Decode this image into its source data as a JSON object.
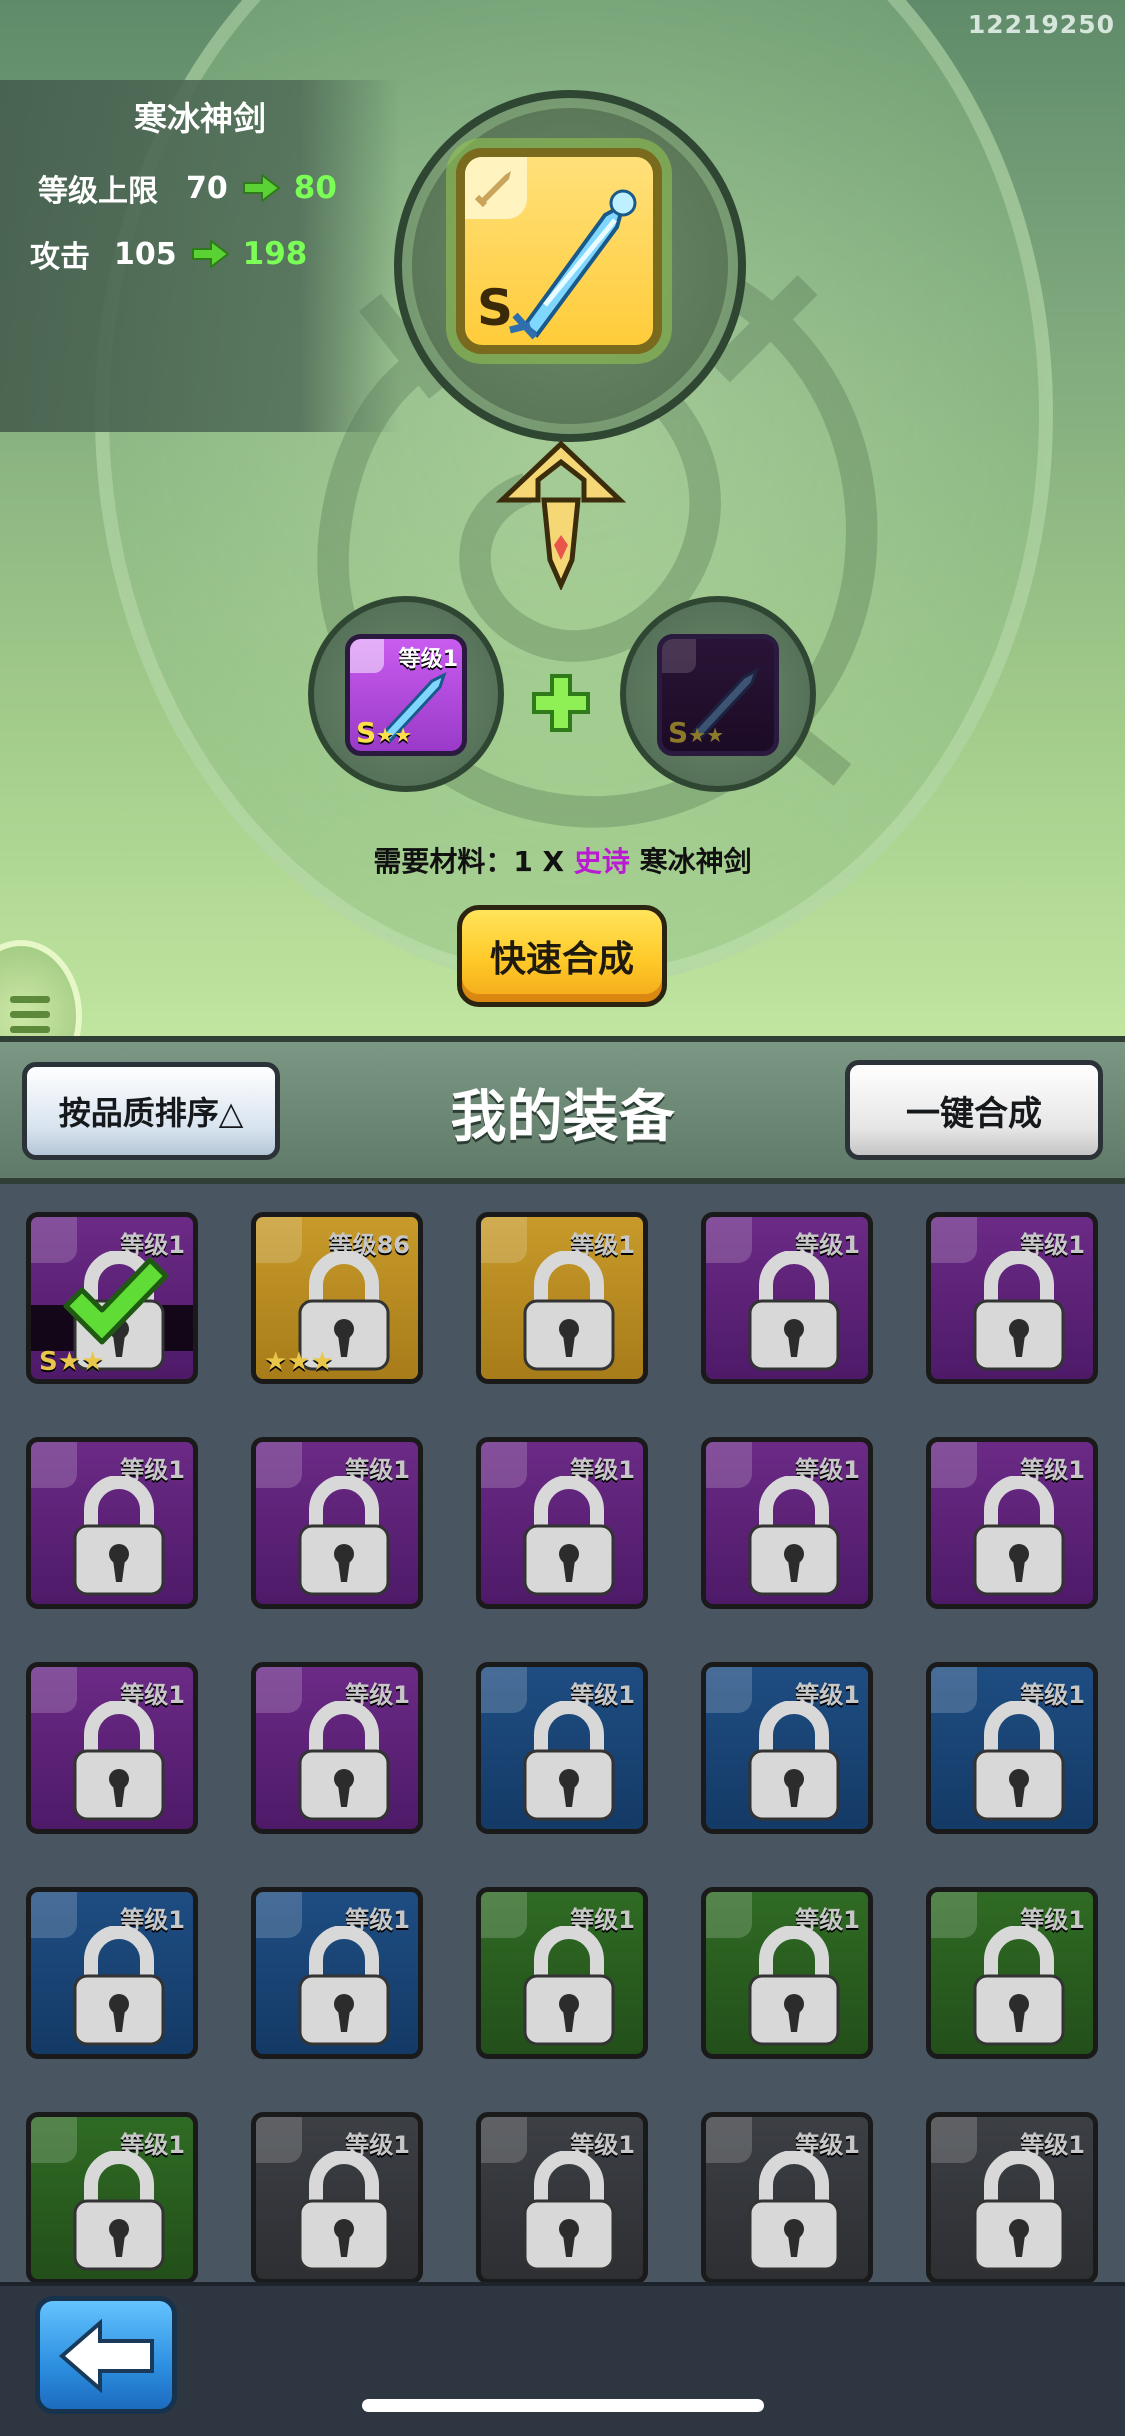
{
  "build_id": "12219250",
  "item": {
    "name": "寒冰神剑",
    "level_cap_label": "等级上限",
    "level_cap_from": "70",
    "level_cap_to": "80",
    "attack_label": "攻击",
    "attack_from": "105",
    "attack_to": "198",
    "rank": "S"
  },
  "materials": [
    {
      "level": "等级1",
      "rank": "S",
      "stars": "★★"
    },
    {
      "level": "",
      "rank": "S",
      "stars": "★★"
    }
  ],
  "requirement": {
    "prefix": "需要材料：1 X ",
    "quality": "史诗",
    "name": " 寒冰神剑"
  },
  "quick_merge_label": "快速合成",
  "section": {
    "sort_label": "按品质排序△",
    "title": "我的装备",
    "merge_all_label": "一键合成"
  },
  "equipment": [
    {
      "level": "等级1",
      "quality": "purple",
      "status": "装备中",
      "rank": "S",
      "stars": "★★"
    },
    {
      "level": "等级86",
      "quality": "gold",
      "status": "",
      "rank": "",
      "stars": "★★★"
    },
    {
      "level": "等级1",
      "quality": "gold",
      "status": ""
    },
    {
      "level": "等级1",
      "quality": "purple",
      "status": ""
    },
    {
      "level": "等级1",
      "quality": "purple",
      "status": ""
    },
    {
      "level": "等级1",
      "quality": "purple",
      "status": ""
    },
    {
      "level": "等级1",
      "quality": "purple",
      "status": ""
    },
    {
      "level": "等级1",
      "quality": "purple",
      "status": ""
    },
    {
      "level": "等级1",
      "quality": "purple",
      "status": ""
    },
    {
      "level": "等级1",
      "quality": "purple",
      "status": ""
    },
    {
      "level": "等级1",
      "quality": "purple",
      "status": ""
    },
    {
      "level": "等级1",
      "quality": "purple",
      "status": ""
    },
    {
      "level": "等级1",
      "quality": "blue",
      "status": ""
    },
    {
      "level": "等级1",
      "quality": "blue",
      "status": ""
    },
    {
      "level": "等级1",
      "quality": "blue",
      "status": ""
    },
    {
      "level": "等级1",
      "quality": "blue",
      "status": ""
    },
    {
      "level": "等级1",
      "quality": "blue",
      "status": ""
    },
    {
      "level": "等级1",
      "quality": "green",
      "status": ""
    },
    {
      "level": "等级1",
      "quality": "green",
      "status": ""
    },
    {
      "level": "等级1",
      "quality": "green",
      "status": ""
    },
    {
      "level": "等级1",
      "quality": "green",
      "status": ""
    },
    {
      "level": "等级1",
      "quality": "gray",
      "status": ""
    },
    {
      "level": "等级1",
      "quality": "gray",
      "status": ""
    },
    {
      "level": "等级1",
      "quality": "gray",
      "status": ""
    },
    {
      "level": "等级1",
      "quality": "gray",
      "status": ""
    }
  ],
  "icons": {
    "back": "back-arrow-icon",
    "menu": "menu-icon",
    "lock": "lock-icon",
    "check": "checkmark-icon",
    "plus": "plus-icon",
    "sword": "sword-icon"
  },
  "colors": {
    "green_value": "#7bff57",
    "epic_purple": "#b91bd2",
    "button_gold": "#ffc928",
    "back_blue": "#2d8fe0"
  }
}
